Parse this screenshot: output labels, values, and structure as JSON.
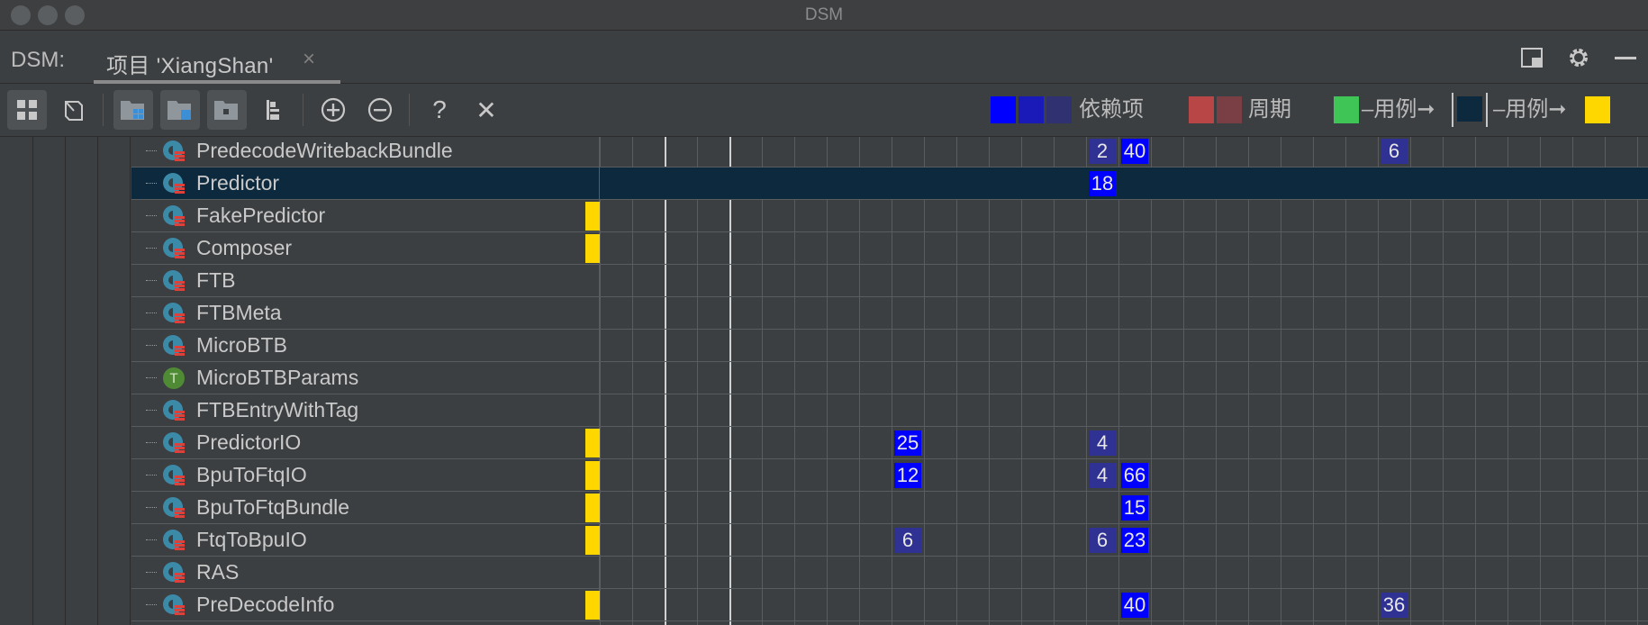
{
  "window": {
    "title": "DSM"
  },
  "tabbar": {
    "label": "DSM:",
    "tab_label": "项目 'XiangShan'",
    "tab_close": "×"
  },
  "toolbar": {
    "buttons": [
      "grid-view",
      "flip",
      "package-modules",
      "package-files",
      "package-folder",
      "hierarchy",
      "expand",
      "collapse",
      "help",
      "close"
    ],
    "help_label": "?",
    "close_label": "✕"
  },
  "legend": {
    "dependencies_label": "依赖项",
    "cycles_label": "周期",
    "usage_label_1": "–用例➞",
    "usage_label_2": "–用例➞",
    "colors": {
      "dep1": "#0000ff",
      "dep2": "#1a1ab8",
      "dep3": "#2f3170",
      "cyc1": "#b94646",
      "cyc2": "#7a3f44",
      "green": "#3fc456",
      "dark": "#0d293e",
      "yellow": "#ffd700"
    }
  },
  "rows": [
    {
      "name": "PredecodeWritebackBundle",
      "icon": "class-icon",
      "yellow": false,
      "selected": false
    },
    {
      "name": "Predictor",
      "icon": "class-icon",
      "yellow": false,
      "selected": true
    },
    {
      "name": "FakePredictor",
      "icon": "class-icon",
      "yellow": true,
      "selected": false
    },
    {
      "name": "Composer",
      "icon": "class-icon",
      "yellow": true,
      "selected": false
    },
    {
      "name": "FTB",
      "icon": "class-icon",
      "yellow": false,
      "selected": false
    },
    {
      "name": "FTBMeta",
      "icon": "class-icon",
      "yellow": false,
      "selected": false
    },
    {
      "name": "MicroBTB",
      "icon": "class-icon",
      "yellow": false,
      "selected": false
    },
    {
      "name": "MicroBTBParams",
      "icon": "trait-icon",
      "yellow": false,
      "selected": false
    },
    {
      "name": "FTBEntryWithTag",
      "icon": "class-icon",
      "yellow": false,
      "selected": false
    },
    {
      "name": "PredictorIO",
      "icon": "class-icon",
      "yellow": true,
      "selected": false
    },
    {
      "name": "BpuToFtqIO",
      "icon": "class-icon",
      "yellow": true,
      "selected": false
    },
    {
      "name": "BpuToFtqBundle",
      "icon": "class-icon",
      "yellow": true,
      "selected": false
    },
    {
      "name": "FtqToBpuIO",
      "icon": "class-icon",
      "yellow": true,
      "selected": false
    },
    {
      "name": "RAS",
      "icon": "class-icon",
      "yellow": false,
      "selected": false
    },
    {
      "name": "PreDecodeInfo",
      "icon": "class-icon",
      "yellow": true,
      "selected": false
    }
  ],
  "cells": [
    {
      "row": 0,
      "col": 15,
      "value": "2",
      "style": "d"
    },
    {
      "row": 0,
      "col": 16,
      "value": "40",
      "style": "b"
    },
    {
      "row": 0,
      "col": 24,
      "value": "6",
      "style": "d"
    },
    {
      "row": 1,
      "col": 15,
      "value": "18",
      "style": "b"
    },
    {
      "row": 9,
      "col": 9,
      "value": "25",
      "style": "b"
    },
    {
      "row": 9,
      "col": 15,
      "value": "4",
      "style": "d"
    },
    {
      "row": 10,
      "col": 9,
      "value": "12",
      "style": "b"
    },
    {
      "row": 10,
      "col": 15,
      "value": "4",
      "style": "d"
    },
    {
      "row": 10,
      "col": 16,
      "value": "66",
      "style": "b"
    },
    {
      "row": 11,
      "col": 16,
      "value": "15",
      "style": "b"
    },
    {
      "row": 12,
      "col": 9,
      "value": "6",
      "style": "d"
    },
    {
      "row": 12,
      "col": 15,
      "value": "6",
      "style": "d"
    },
    {
      "row": 12,
      "col": 16,
      "value": "23",
      "style": "b"
    },
    {
      "row": 14,
      "col": 16,
      "value": "40",
      "style": "b"
    },
    {
      "row": 14,
      "col": 24,
      "value": "36",
      "style": "d"
    }
  ]
}
